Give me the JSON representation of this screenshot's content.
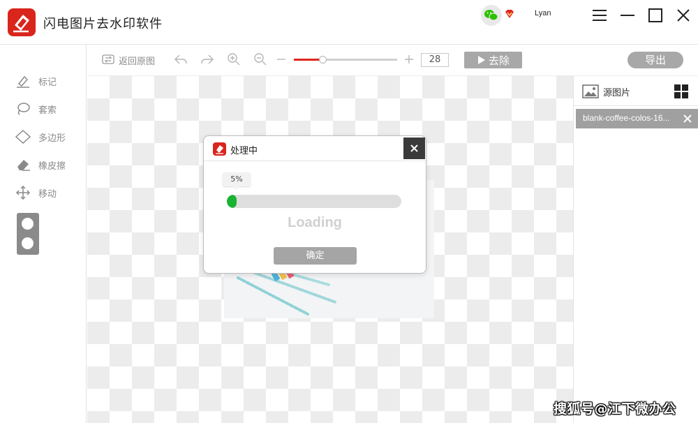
{
  "app": {
    "title": "闪电图片去水印软件",
    "username": "Lyan"
  },
  "colors": {
    "brand": "#d9251c",
    "progress": "#19b331",
    "button_gray": "#a8a8a8"
  },
  "window_controls": [
    "menu-icon",
    "minimize-icon",
    "maximize-icon",
    "close-icon"
  ],
  "tools": [
    {
      "label": "标记",
      "icon": "marker-icon"
    },
    {
      "label": "套索",
      "icon": "lasso-icon"
    },
    {
      "label": "多边形",
      "icon": "polygon-icon"
    },
    {
      "label": "橡皮擦",
      "icon": "eraser-icon"
    },
    {
      "label": "移动",
      "icon": "move-icon"
    }
  ],
  "toolbar": {
    "restore_label": "返回原图",
    "zoom_value": "28",
    "zoom_fraction": 0.28,
    "remove_label": "去除",
    "export_label": "导出"
  },
  "right_panel": {
    "title": "源图片",
    "files": [
      {
        "name": "blank-coffee-colos-16..."
      }
    ]
  },
  "dialog": {
    "title": "处理中",
    "percent_label": "5%",
    "percent": 5,
    "loading_text": "Loading",
    "ok_label": "确定"
  },
  "watermark": "搜狐号@江下微办公"
}
